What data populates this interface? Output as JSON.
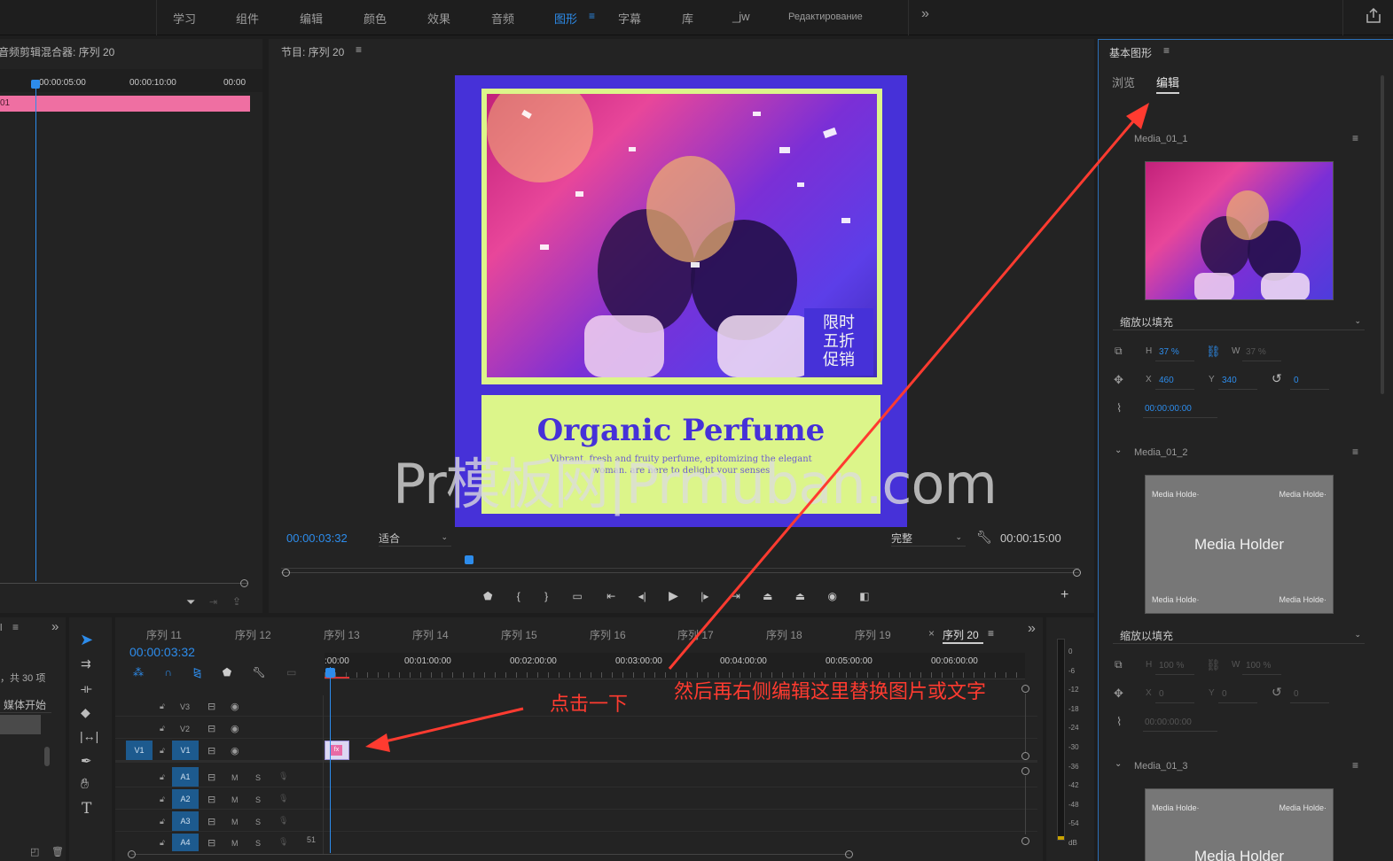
{
  "workspace_tabs": [
    "学习",
    "组件",
    "编辑",
    "颜色",
    "效果",
    "音频",
    "图形",
    "字幕",
    "库",
    "_jw",
    "Редактирование"
  ],
  "active_workspace": "图形",
  "mixer": {
    "title": "音频剪辑混合器: 序列 20",
    "ruler": [
      "00:00:05:00",
      "00:00:10:00",
      "00:00"
    ],
    "clip_label": "01"
  },
  "program": {
    "title": "节目: 序列 20",
    "timecode": "00:00:03:32",
    "fit": "适合",
    "quality": "完整",
    "duration": "00:00:15:00",
    "poster": {
      "badge": [
        "限时",
        "五折",
        "促销"
      ],
      "headline": "Organic Perfume",
      "body_line1": "Vibrant, fresh and fruity perfume, epitomizing the elegant",
      "body_line2": "woman. are here to delight your senses"
    },
    "watermark": "Pr模板网|Prmuban.com"
  },
  "essential_graphics": {
    "title": "基本图形",
    "tabs": [
      "浏览",
      "编辑"
    ],
    "active_tab": "编辑",
    "layers": [
      {
        "name": "Media_01_1",
        "scale_mode": "缩放以填充",
        "h": "37 %",
        "w": "37 %",
        "x": "460",
        "y": "340",
        "rot": "0",
        "time": "00:00:00:00"
      },
      {
        "name": "Media_01_2",
        "scale_mode": "缩放以填充",
        "h": "100 %",
        "w": "100 %",
        "x": "0",
        "y": "0",
        "rot": "0",
        "time": "00:00:00:00"
      },
      {
        "name": "Media_01_3"
      }
    ],
    "labels": {
      "h": "H",
      "w": "W",
      "x": "X",
      "y": "Y"
    },
    "media_holder": {
      "center": "Media Holder",
      "corner": "Media Holde·"
    }
  },
  "project": {
    "count": "，共 30 项",
    "col": "媒体开始"
  },
  "timeline": {
    "tabs": [
      "序列 11",
      "序列 12",
      "序列 13",
      "序列 14",
      "序列 15",
      "序列 16",
      "序列 17",
      "序列 18",
      "序列 19",
      "序列 20"
    ],
    "active_tab": "序列 20",
    "timecode": "00:00:03:32",
    "ruler": [
      ":00:00",
      "00:01:00:00",
      "00:02:00:00",
      "00:03:00:00",
      "00:04:00:00",
      "00:05:00:00",
      "00:06:00:00"
    ],
    "video_tracks": [
      "V3",
      "V2",
      "V1"
    ],
    "audio_tracks": [
      "A1",
      "A2",
      "A3",
      "A4"
    ],
    "source_patch": "V1",
    "m": "M",
    "s": "S",
    "a4_extra": "51"
  },
  "meter": {
    "scale": [
      "0",
      "-6",
      "-12",
      "-18",
      "-24",
      "-30",
      "-36",
      "-42",
      "-48",
      "-54",
      "dB"
    ]
  },
  "annotations": {
    "click": "点击一下",
    "edit_hint": "然后再右侧编辑这里替换图片或文字"
  },
  "colors": {
    "accent": "#2d8ceb",
    "poster_bg": "#4631d8",
    "poster_lime": "#dcf58a",
    "clip_pink": "#ef6fa2",
    "annotation": "#ff3b30"
  }
}
